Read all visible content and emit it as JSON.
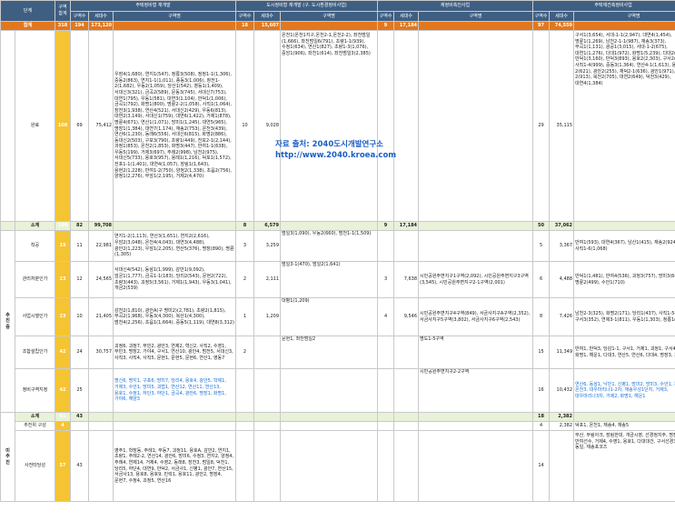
{
  "headers": {
    "stage": "단계",
    "district_total": "구역\n합계",
    "g1": "주택정비형 재개발",
    "g2": "도시정비형 재개발 (구. 도시환경정비사업)",
    "g3": "재정비촉진사업",
    "g4": "주택재건축정비사업",
    "count": "구역수",
    "households": "세대수",
    "zone_name": "구역명"
  },
  "total_row": {
    "label": "합계",
    "total": "318",
    "g1_count": "194",
    "g1_hh": "173,120",
    "g2_count": "18",
    "g2_hh": "15,607",
    "g3_count": "9",
    "g3_hh": "17,184",
    "g4_count": "97",
    "g4_hh": "74,559"
  },
  "rows": [
    {
      "stage": "",
      "label": "완료",
      "total": "108",
      "g1_count": "69",
      "g1_hh": "75,412",
      "g1_names": "우장4(1,680), 연지1(547), 정릉3(508), 정정1-1(1,306), 중동2(863), 연지1-1(1,011), 종동3(1,006), 창전1-2(1,682), 우동2(1,059), 당산1(542), 영등1(1,409), 서대신3(321), 금곡2(589), 문동3(745), 서대신7(753), 대연1(795), 우동1(581), 대연3(1,104), 만덕1(1,006), 금곡1(792), 화명1(800), 명륜2-2(1,058), 사직1(1,064), 장전3(1,938), 연산4(521), 서대신2(429), 우동6(813), 대연2(3,149), 서대신1(759), 대연6(1,422), 거제1(878), 명륜4(671), 연산1(1,071), 망미1(1,245), 대연5(965), 명장1(1,384), 대연7(1,174), 재송2(753), 온천3(439), 연산6(1,230), 동래6(556), 서대신6(815), 화명2(886), 동대신2(503), 구포3(790), 초량1(449), 전포2-1(2,144), 과정1(853), 온천2(1,853), 화명3(447), 반여1-1(638), 우동5(199), 거제3(697), 주례2(998), 남천2(975), 서대신5(733), 용호3(957), 용례1(1,216), 덕포1(1,572), 전포1-1(1,401), 대연4(1,057), 장림1(1,643), 용현2(1,228), 반여1-2(750), 양정2(1,338), 초읍2(756), 양정1(2,276), 부암1(2,195), 거제2(4,470)",
      "g2_count": "10",
      "g2_hh": "9,028",
      "g2_names": "온천1(온천1지구,온천2-1,온천2-2), 좌천범일(1,666), 좌천범일6(791), 초량1-1(939), 수정1(634), 연산1(827), 초량1-3(1,076), 중앙1(906), 좌천1(614), 좌천범일3(2,385)",
      "g3_count": "",
      "g3_hh": "",
      "g3_names": "",
      "g4_count": "29",
      "g4_hh": "35,115",
      "g4_names": "구서1(3,654), 서대-1-1(2,947), 대연4(1,454), 명륜1(1,269), 남천2-1-1(987), 재송3(373), 부곡1(1,131), 광공1(3,015), 서대-1-2(675), 대연1(1,276), 다대1(972), 화명1(5,239), 다대2(1,326), 만덕1(3,160), 만덕3(893), 용호2(2,303), 구서2(693), 사직1-4(999), 중동3(1,364), 연산4-1(1,613), 용호2-1-2(621), 광안2(255), 재덕2-1(636), 광안1(971), 남천2-2(913), 북천2(705), 대연2(649), 덕천3(429), 대연4(1,384)"
    },
    {
      "stage": "",
      "label": "소계",
      "sub": true,
      "total": "149",
      "g1_count": "82",
      "g1_hh": "99,708",
      "g2_count": "8",
      "g2_hh": "6,579",
      "g3_count": "9",
      "g3_hh": "17,184",
      "g4_count": "50",
      "g4_hh": "37,062"
    },
    {
      "stage": "",
      "label": "착공",
      "total": "19",
      "g1_count": "11",
      "g1_hh": "22,981",
      "g1_names": "연지1-2(1,113), 연산3(1,651), 연지2(2,616), 우암2(3,048), 온천4(4,043), 대연3(4,488), 광안2(1,223), 우암1(2,205), 연산5(376), 명장(890), 명륜(1,305)",
      "g2_count": "3",
      "g2_hh": "3,259",
      "g2_names": "범일3(1,090), 우동2(660), 범천1-1(1,509)",
      "g3_count": "",
      "g3_hh": "",
      "g3_names": "",
      "g4_count": "5",
      "g4_hh": "3,367",
      "g4_names": "반여1(593), 대연4(367), 남산1(415), 재송2(924), 사직1-6(1,068)"
    },
    {
      "stage": "",
      "label": "관리처분인가",
      "total": "23",
      "g1_count": "12",
      "g1_hh": "24,565",
      "g1_names": "서대신4(542), 동삼1(1,999), 감만1(9,092), 엄궁1(1,777), 금곡1-1(183), 당리2(543), 문현2(722), 초량3(443), 괴정5(3,561), 거제1(1,943), 우동3(1,041), 개금2(539)",
      "g2_count": "2",
      "g2_hh": "2,111",
      "g2_names": "범일3-1(470), 범일2(1,641)",
      "g3_count": "3",
      "g3_hh": "7,638",
      "g3_names": "시민공원주변지구1구역(2,092), 시민공원주변지구3구역(3,545), 시민공원주변지구2-1구역(2,001)",
      "g4_count": "6",
      "g4_hh": "4,488",
      "g4_names": "만덕1(1,481), 반여4(536), 괴정3(757), 망미3(605), 명륜2(499), 수안1(710)"
    },
    {
      "stage": "추\n진\n중",
      "label": "사업시행인가",
      "total": "23",
      "g1_count": "10",
      "g1_hh": "21,405",
      "g1_names": "감천2(1,810), 광안A(구 명미2)(2,781), 초량2(1,815), 부곡2(1,968), 우동3(4,300), 복산1(4,300), 범천4(2,256), 초읍1(1,664), 중동5(1,119), 대연8(3,312)",
      "g2_count": "1",
      "g2_hh": "1,209",
      "g2_names": "대평1(1,209)",
      "g3_count": "4",
      "g3_hh": "9,546",
      "g3_names": "시민공원주변지구4구역(849), 서금사지구A구역(2,352), 서금사지구5구역(3,802), 서금사지구6구역(2,543)",
      "g4_count": "8",
      "g4_hh": "7,426",
      "g4_names": "남천2-3(325), 화명2(171), 당리1(437), 사직1-5(549), 구서3(352), 연제3-1(811), 우동1(1,303), 청룡1(278)"
    },
    {
      "stage": "",
      "label": "조합설립인가",
      "total": "42",
      "g1_count": "24",
      "g1_hh": "30,757",
      "g1_names": "괴정6, 괴정7, 부민2, 광안3, 연제2, 혁신2, 사직2, 수영1, 부민3, 명장2, 가야4, 구서1, 연산10, 광안4, 범전5, 서대신3, 사직3, 사직4, 사직5, 문현1, 문현5, 문현6, 연산1, 영동7",
      "g2_count": "2",
      "g2_hh": "",
      "g2_names": "문현1, 좌천범일2",
      "g3_count": "",
      "g3_hh": "",
      "g3_names": "명도1-5구역",
      "g4_count": "15",
      "g4_hh": "11,349",
      "g4_names": "반여1, 만덕3, 당감1-1, 구서1, 거제1, 괴정1, 구서4, 명주1, 화명1, 해운1, 다대3, 연산5, 연산6, 다대4, 명장3, 거제2"
    },
    {
      "stage": "",
      "label": "정비구역지정",
      "total": "42",
      "g1_count": "25",
      "g1_hh": "",
      "g1_names": "명신6, 명지1, 구포6, 망미7, 당리4, 용호4, 광안5, 학제1, 거제3, 수안1, 망미5, 괴법1, 연산12, 연산11, 연산13, 용호1, 수정1, 하단3, 하단1, 금곡4, 광안6, 명장1, 화명1, 가야6, 해양3",
      "g2_count": "",
      "g2_hh": "",
      "g2_names": "",
      "g3_count": "",
      "g3_hh": "",
      "g3_names": "시민공원주변지구2-2구역",
      "g4_count": "16",
      "g4_hh": "10,432",
      "g4_names": "연산6, 동삼1, 낙민1, 신평1, 망미2, 망미3, 수안1, 동대신1, 온천3, 대우마리나1-2차, 재송우성1단지, 거제3, 대우마리나3차, 거제2, 화명1, 해운1"
    },
    {
      "stage": "",
      "label": "소계",
      "sub": true,
      "total": "61",
      "g1_count": "43",
      "g1_hh": "",
      "g2_count": "",
      "g2_hh": "",
      "g3_count": "",
      "g3_hh": "",
      "g4_count": "18",
      "g4_hh": "2,382"
    },
    {
      "stage": "미\n추\n진",
      "label": "추진위 구성",
      "total": "4",
      "g1_count": "",
      "g1_hh": "",
      "g1_names": "",
      "g2_count": "",
      "g2_hh": "",
      "g2_names": "",
      "g3_count": "",
      "g3_hh": "",
      "g3_names": "",
      "g4_count": "4",
      "g4_hh": "2,382",
      "g4_names": "덕포1, 온천1, 재송4, 재송5"
    },
    {
      "stage": "",
      "label": "사전타당성",
      "total": "57",
      "g1_count": "43",
      "g1_hh": "",
      "g1_names": "영주1, 학장동, 주례1, 부동7, 괴정11, 용호A, 감만2, 연지1, 초량1, 주례2-2, 연산14, 광안6, 망미6, 수정3, 연지2, 양정4, 주례4, 연제14, 거제4, 수영2, 동래8, 장전3, 범일8, 덕천1, 당리5, 하단4, 대연9, 만덕2, 서금사1, 신평1, 광안7, 연산15, 서금사13, 용호8, 용호9, 민락1, 용호11, 광안2, 명장4, 문현7, 수정4, 괴정5, 연산16",
      "g2_count": "",
      "g2_hh": "",
      "g2_names": "",
      "g3_count": "",
      "g3_hh": "",
      "g3_names": "",
      "g4_count": "14",
      "g4_hh": "",
      "g4_names": "부산, 부림아크, 장림한대, 개금시영, 선경정지주, 명장, 반여선수, 거제4, 수영1, 용호1, 다대대건, 구서선경3차, 동일, 재송포코즈"
    }
  ],
  "watermark": {
    "line1": "자료 출처: 2040도시개발연구소",
    "line2": "http://www.2040.kroea.com"
  }
}
